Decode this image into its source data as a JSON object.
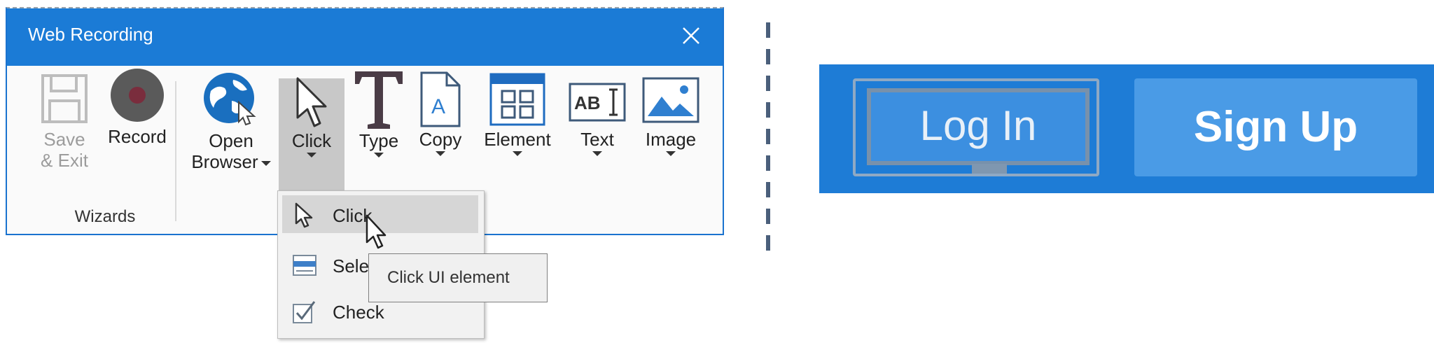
{
  "window": {
    "title": "Web Recording"
  },
  "ribbon": {
    "save_exit": "Save\n& Exit",
    "save_line1": "Save",
    "save_line2": "& Exit",
    "record": "Record",
    "wizards_group": "Wizards",
    "open_line1": "Open",
    "open_line2": "Browser",
    "click": "Click",
    "type": "Type",
    "copy": "Copy",
    "element": "Element",
    "text": "Text",
    "image": "Image"
  },
  "click_menu": {
    "items": [
      {
        "label": "Click",
        "icon": "cursor-icon"
      },
      {
        "label": "Sele",
        "icon": "select-list-icon"
      },
      {
        "label": "Check",
        "icon": "checkbox-icon"
      }
    ]
  },
  "tooltip": {
    "text": "Click UI element"
  },
  "preview": {
    "login_label": "Log In",
    "signup_label": "Sign Up"
  },
  "colors": {
    "titlebar": "#1b7bd6",
    "preview_bg": "#1e7cd6",
    "signup_bg": "#4a9be6"
  }
}
